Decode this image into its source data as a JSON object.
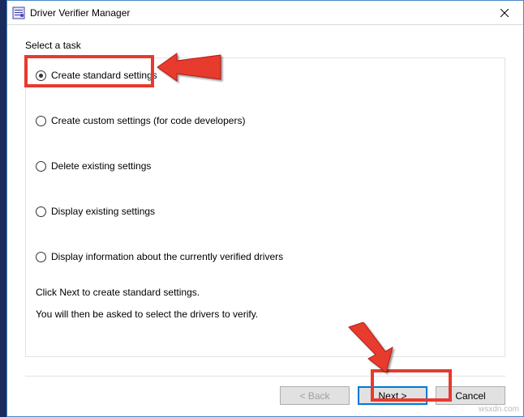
{
  "titlebar": {
    "title": "Driver Verifier Manager"
  },
  "content": {
    "task_label": "Select a task",
    "options": {
      "create_standard": "Create standard settings",
      "create_custom": "Create custom settings (for code developers)",
      "delete_existing": "Delete existing settings",
      "display_existing": "Display existing settings",
      "display_info": "Display information about the currently verified drivers"
    },
    "hint_line1": "Click Next to create standard settings.",
    "hint_line2": "You will then be asked to select the drivers to verify."
  },
  "buttons": {
    "back": "< Back",
    "next": "Next >",
    "cancel": "Cancel"
  },
  "watermark": "wsxdn.com",
  "icons": {
    "app": "app-icon",
    "close": "close-icon"
  },
  "annotation": {
    "highlight_color": "#e73a2e"
  }
}
